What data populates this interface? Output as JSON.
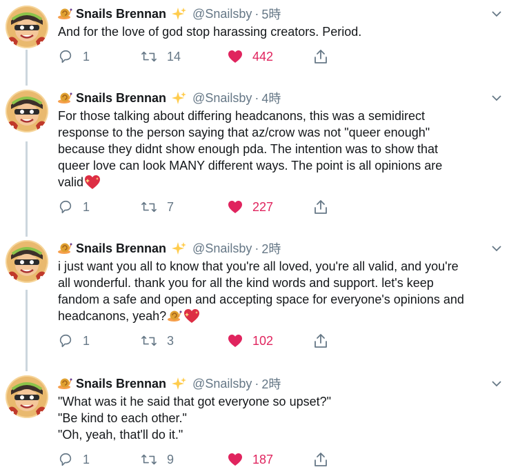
{
  "tweets": [
    {
      "author": "Snails Brennan",
      "handle": "@Snailsby",
      "time": "5時",
      "lines": [
        "And for the love of god stop harassing creators. Period."
      ],
      "replies": "1",
      "retweets": "14",
      "likes": "442"
    },
    {
      "author": "Snails Brennan",
      "handle": "@Snailsby",
      "time": "4時",
      "lines": [
        "For those talking about differing headcanons, this was a semidirect",
        "response to the person saying that az/crow was not \"queer enough\"",
        "because they didnt show enough pda. The intention was to show that",
        "queer love can look MANY different ways. The point is all opinions are",
        "valid"
      ],
      "replies": "1",
      "retweets": "7",
      "likes": "227"
    },
    {
      "author": "Snails Brennan",
      "handle": "@Snailsby",
      "time": "2時",
      "lines": [
        "i just want you all to know that you're all loved, you're all valid, and you're",
        "all wonderful. thank you for all the kind words and support. let's keep",
        "fandom a safe and open and accepting space for everyone's opinions and",
        "headcanons, yeah?"
      ],
      "replies": "1",
      "retweets": "3",
      "likes": "102"
    },
    {
      "author": "Snails Brennan",
      "handle": "@Snailsby",
      "time": "2時",
      "lines": [
        "\"What was it he said that got everyone so upset?\"",
        "\"Be kind to each other.\"",
        "\"Oh, yeah, that'll do it.\""
      ],
      "replies": "1",
      "retweets": "9",
      "likes": "187"
    }
  ],
  "colors": {
    "text": "#14171a",
    "muted": "#657786",
    "like": "#e0245e",
    "thread": "#ccd6dd"
  },
  "icons": [
    "snail-emoji",
    "sparkles-emoji",
    "chevron-down-icon",
    "reply-icon",
    "retweet-icon",
    "heart-icon",
    "share-icon",
    "sparkling-heart-emoji"
  ]
}
